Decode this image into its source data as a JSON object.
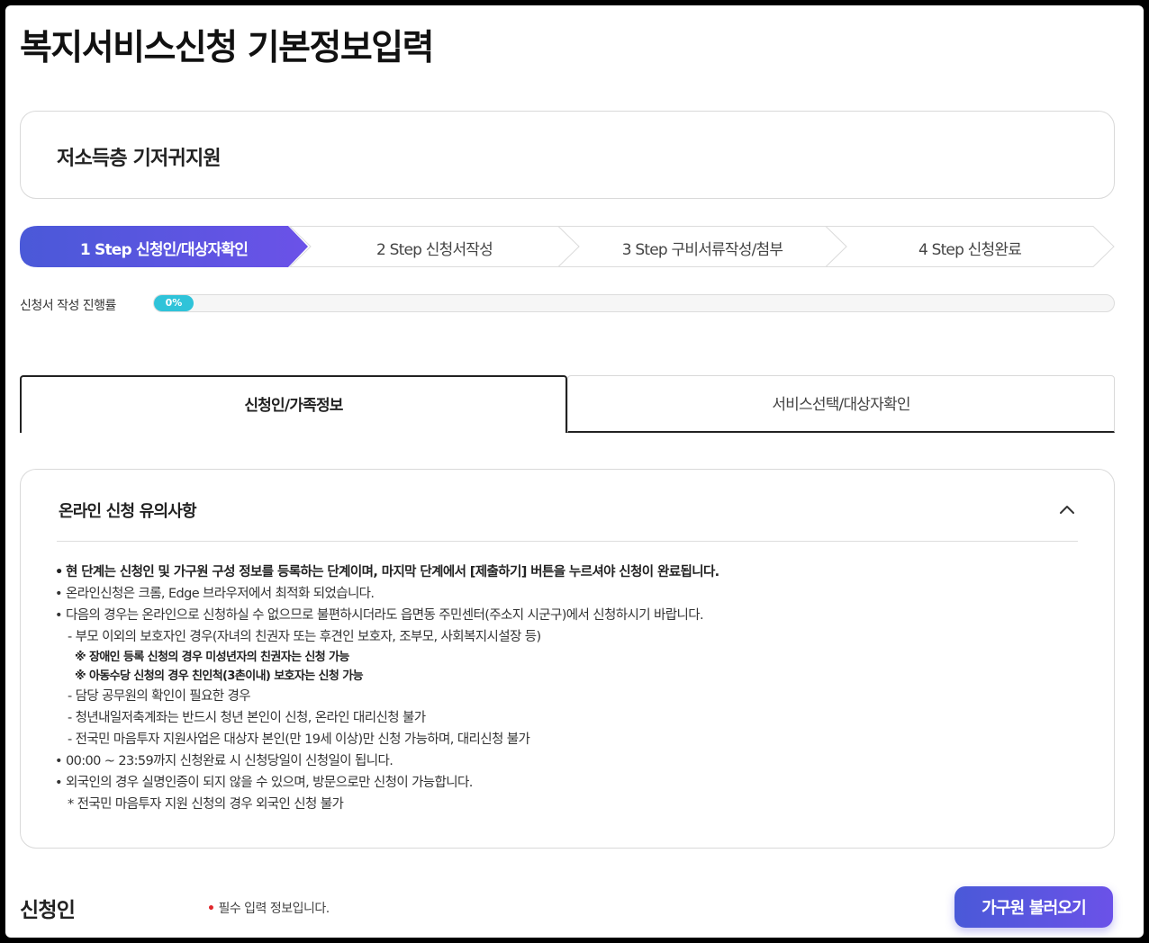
{
  "page": {
    "title": "복지서비스신청 기본정보입력"
  },
  "service": {
    "name": "저소득층 기저귀지원"
  },
  "steps": [
    {
      "label": "1 Step 신청인/대상자확인",
      "active": true
    },
    {
      "label": "2 Step 신청서작성",
      "active": false
    },
    {
      "label": "3 Step 구비서류작성/첨부",
      "active": false
    },
    {
      "label": "4 Step 신청완료",
      "active": false
    }
  ],
  "progress": {
    "label": "신청서 작성 진행률",
    "value_text": "0%",
    "value": 0,
    "color": "#2fc3d9"
  },
  "tabs": [
    {
      "label": "신청인/가족정보",
      "active": true
    },
    {
      "label": "서비스선택/대상자확인",
      "active": false
    }
  ],
  "notice": {
    "title": "온라인 신청 유의사항",
    "toggle_icon": "chevron-up-icon",
    "lines": [
      {
        "text": "현 단계는 신청인 및 가구원 구성 정보를 등록하는 단계이며, 마지막 단계에서 [제출하기] 버튼을 누르셔야 신청이 완료됩니다.",
        "bullet": "•"
      },
      {
        "text": "온라인신청은 크롬, Edge 브라우저에서 최적화 되었습니다.",
        "bullet": "•"
      },
      {
        "text": "다음의 경우는 온라인으로 신청하실 수 없으므로 불편하시더라도 읍면동 주민센터(주소지 시군구)에서 신청하시기 바랍니다.",
        "bullet": "•"
      },
      {
        "text": "- 부모 이외의 보호자인 경우(자녀의 친권자 또는 후견인 보호자, 조부모, 사회복지시설장 등)"
      },
      {
        "text": "※ 장애인 등록 신청의 경우 미성년자의 친권자는 신청 가능"
      },
      {
        "text": "※ 아동수당 신청의 경우 친인척(3촌이내) 보호자는 신청 가능"
      },
      {
        "text": "- 담당 공무원의 확인이 필요한 경우"
      },
      {
        "text": "- 청년내일저축계좌는 반드시 청년 본인이 신청, 온라인 대리신청 불가"
      },
      {
        "text": "- 전국민 마음투자 지원사업은 대상자 본인(만 19세 이상)만 신청 가능하며, 대리신청 불가"
      },
      {
        "text": "00:00 ~ 23:59까지 신청완료 시 신청당일이 신청일이 됩니다.",
        "bullet": "•"
      },
      {
        "text": "외국인의 경우 실명인증이 되지 않을 수 있으며, 방문으로만 신청이 가능합니다.",
        "bullet": "•"
      },
      {
        "text": "* 전국민 마음투자 지원 신청의 경우 외국인 신청 불가"
      }
    ]
  },
  "applicant": {
    "section_title": "신청인",
    "required_marker": "•",
    "required_text": "필수 입력 정보입니다.",
    "load_family_button": "가구원 불러오기"
  },
  "colors": {
    "accent_start": "#4a59d8",
    "accent_end": "#6b52e8",
    "progress": "#2fc3d9",
    "required": "#e0262b"
  }
}
